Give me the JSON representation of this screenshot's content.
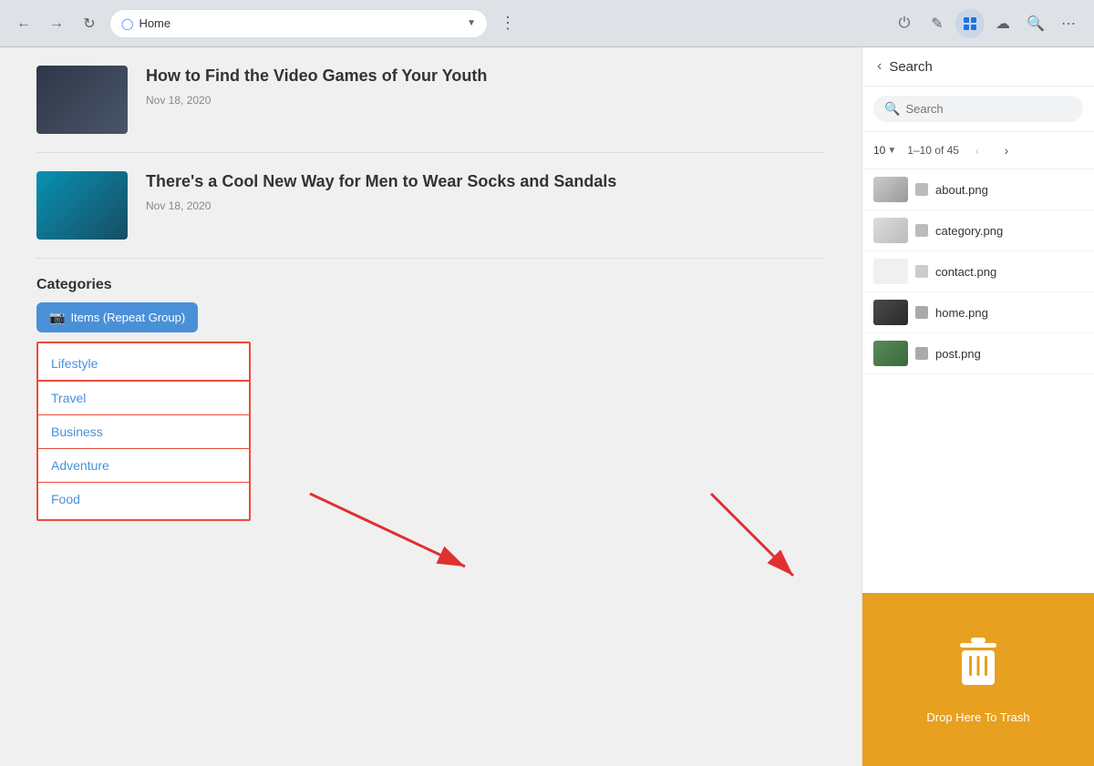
{
  "browser": {
    "back_label": "←",
    "forward_label": "→",
    "refresh_label": "↺",
    "address": "Home",
    "menu_label": "⋮",
    "toolbar": {
      "power_icon": "⏻",
      "edit_icon": "✏",
      "grid_icon": "⊞",
      "cloud_icon": "☁",
      "search_icon": "🔍",
      "apps_icon": "⠿"
    }
  },
  "articles": [
    {
      "title": "How to Find the Video Games of Your Youth",
      "date": "Nov 18, 2020",
      "thumb_class": "thumb-video"
    },
    {
      "title": "There's a Cool New Way for Men to Wear Socks and Sandals",
      "date": "Nov 18, 2020",
      "thumb_class": "thumb-water"
    }
  ],
  "categories": {
    "label": "Categories",
    "button_label": "Items (Repeat Group)",
    "items": [
      "Lifestyle",
      "Travel",
      "Business",
      "Adventure",
      "Food"
    ]
  },
  "sidebar": {
    "search_panel_title": "Search",
    "search_placeholder": "Search",
    "pagination": {
      "per_page": "10",
      "range": "1–10 of 45",
      "prev_label": "‹",
      "next_label": "›"
    },
    "files": [
      {
        "name": "about.png",
        "thumb": "about"
      },
      {
        "name": "category.png",
        "thumb": "category"
      },
      {
        "name": "contact.png",
        "thumb": "contact"
      },
      {
        "name": "home.png",
        "thumb": "home"
      },
      {
        "name": "post.png",
        "thumb": "post"
      }
    ],
    "drop_trash_label": "Drop Here To Trash",
    "bottom_file": "big_image_3.jpg"
  }
}
